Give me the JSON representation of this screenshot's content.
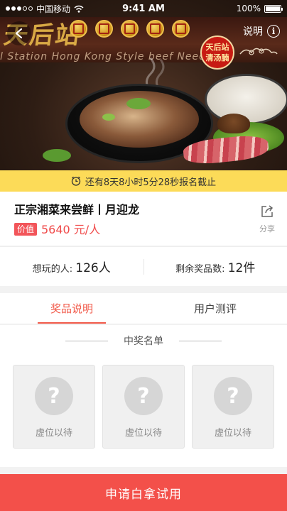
{
  "status_bar": {
    "carrier": "中国移动",
    "time": "9:41 AM",
    "battery": "100%"
  },
  "header": {
    "info_label": "说明",
    "info_icon": "info-icon",
    "back_icon": "chevron-left-icon"
  },
  "hero": {
    "brand_script": "天后站",
    "subtitle": "l Station  Hong Kong Style beef  Needle",
    "stamp_line1": "天后站",
    "stamp_line2": "清汤腩"
  },
  "countdown": {
    "text": "还有8天8小时5分28秒报名截止",
    "icon": "clock-icon"
  },
  "product": {
    "title": "正宗湘菜来尝鲜丨月迎龙",
    "value_tag": "价值",
    "price": "5640 元/人",
    "share_label": "分享",
    "share_icon": "share-icon"
  },
  "stats": {
    "interested_label": "想玩的人:",
    "interested_value": "126人",
    "remaining_label": "剩余奖品数:",
    "remaining_value": "12件"
  },
  "tabs": [
    {
      "label": "奖品说明",
      "active": true
    },
    {
      "label": "用户测评",
      "active": false
    }
  ],
  "winners": {
    "heading": "中奖名单",
    "slots": [
      {
        "label": "虚位以待"
      },
      {
        "label": "虚位以待"
      },
      {
        "label": "虚位以待"
      }
    ]
  },
  "cta": {
    "label": "申请白拿试用"
  },
  "colors": {
    "accent": "#f3504a",
    "countdown_bg": "#fcdb58",
    "price": "#f04a4a"
  }
}
